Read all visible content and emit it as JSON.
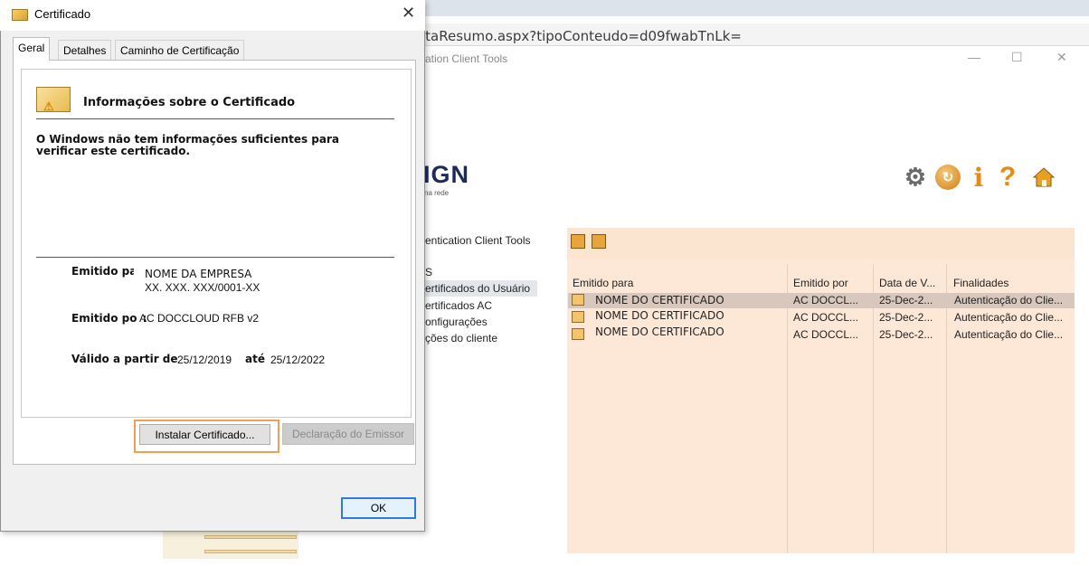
{
  "browser": {
    "url": "ltaResumo.aspx?tipoConteudo=d09fwabTnLk="
  },
  "app": {
    "title_fragment": "ation Client Tools",
    "logo_text": "IGN",
    "logo_sub": "na rede",
    "toolbar_icons": [
      "gear-icon",
      "refresh-icon",
      "info-icon",
      "help-icon",
      "home-icon"
    ],
    "nav": {
      "items": [
        "entication Client Tools",
        "S",
        "ertificados do Usuário",
        "ertificados AC",
        "onfigurações",
        "ções do cliente"
      ],
      "selected_index": 2
    },
    "table": {
      "columns": [
        "Emitido para",
        "Emitido por",
        "Data de V...",
        "Finalidades"
      ],
      "rows": [
        {
          "emitido_para": "NOME DO CERTIFICADO",
          "emitido_por": "AC DOCCL...",
          "data": "25-Dec-2...",
          "finalidades": "Autenticação do Clie..."
        },
        {
          "emitido_para": "NOME DO CERTIFICADO",
          "emitido_por": "AC DOCCL...",
          "data": "25-Dec-2...",
          "finalidades": "Autenticação do Clie..."
        },
        {
          "emitido_para": "NOME DO CERTIFICADO",
          "emitido_por": "AC DOCCL...",
          "data": "25-Dec-2...",
          "finalidades": "Autenticação do Clie..."
        }
      ],
      "selected_row": 0
    },
    "colors": {
      "panel_bg": "#fde8d8",
      "accent_orange": "#e38b12"
    }
  },
  "dialog": {
    "title": "Certificado",
    "close": "✕",
    "tabs": [
      "Geral",
      "Detalhes",
      "Caminho de Certificação"
    ],
    "active_tab": "Geral",
    "info_heading": "Informações sobre o Certificado",
    "warning": "O Windows não tem informações suficientes para verificar este certificado.",
    "issued_to_label": "Emitido para:",
    "issued_to_name": "NOME DA EMPRESA",
    "issued_to_cnpj": "XX. XXX. XXX/0001-XX",
    "issued_by_label": "Emitido por:",
    "issued_by": "AC DOCCLOUD RFB v2",
    "valid_from_label": "Válido a partir de",
    "valid_from": "25/12/2019",
    "until_label": "até",
    "valid_to": "25/12/2022",
    "buttons": {
      "install": "Instalar Certificado...",
      "issuer_statement": "Declaração do Emissor",
      "ok": "OK"
    },
    "colors": {
      "highlight": "#f0a050",
      "ok_border": "#2f7bd6"
    }
  }
}
